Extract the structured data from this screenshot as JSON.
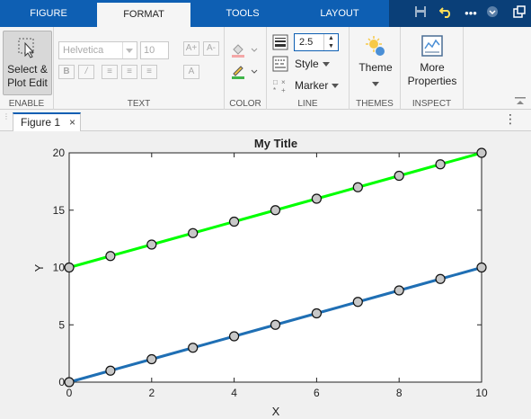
{
  "tabs": [
    {
      "label": "FIGURE"
    },
    {
      "label": "FORMAT"
    },
    {
      "label": "TOOLS"
    },
    {
      "label": "LAYOUT"
    }
  ],
  "icons": {
    "save": "save-icon",
    "undo": "undo-icon",
    "more": "more-icon",
    "collapse": "collapse-icon",
    "undock": "undock-icon"
  },
  "toolstrip": {
    "enable": {
      "label": "ENABLE",
      "select_line1": "Select &",
      "select_line2": "Plot Edit"
    },
    "text": {
      "label": "TEXT",
      "font": "Helvetica",
      "size": "10"
    },
    "color": {
      "label": "COLOR"
    },
    "line": {
      "label": "LINE",
      "width": "2.5",
      "style": "Style",
      "marker": "Marker"
    },
    "themes": {
      "label": "THEMES",
      "theme": "Theme"
    },
    "inspect": {
      "label": "INSPECT",
      "more_line1": "More",
      "more_line2": "Properties"
    }
  },
  "document": {
    "tab": "Figure 1"
  },
  "chart_data": {
    "type": "line",
    "title": "My Title",
    "xlabel": "X",
    "ylabel": "Y",
    "xlim": [
      0,
      10
    ],
    "ylim": [
      0,
      20
    ],
    "xticks": [
      0,
      2,
      4,
      6,
      8,
      10
    ],
    "yticks": [
      0,
      5,
      10,
      15,
      20
    ],
    "grid": false,
    "x": [
      0,
      1,
      2,
      3,
      4,
      5,
      6,
      7,
      8,
      9,
      10
    ],
    "series": [
      {
        "values": [
          0,
          1,
          2,
          3,
          4,
          5,
          6,
          7,
          8,
          9,
          10
        ],
        "color": "#1f6fb4",
        "marker": "circle"
      },
      {
        "values": [
          10,
          11,
          12,
          13,
          14,
          15,
          16,
          17,
          18,
          19,
          20
        ],
        "color": "#00ff00",
        "marker": "circle"
      }
    ],
    "marker_face": "#c8c8c8"
  },
  "colors": {
    "accent": "#0e5fb3",
    "quick_access": "#0a3f78"
  }
}
